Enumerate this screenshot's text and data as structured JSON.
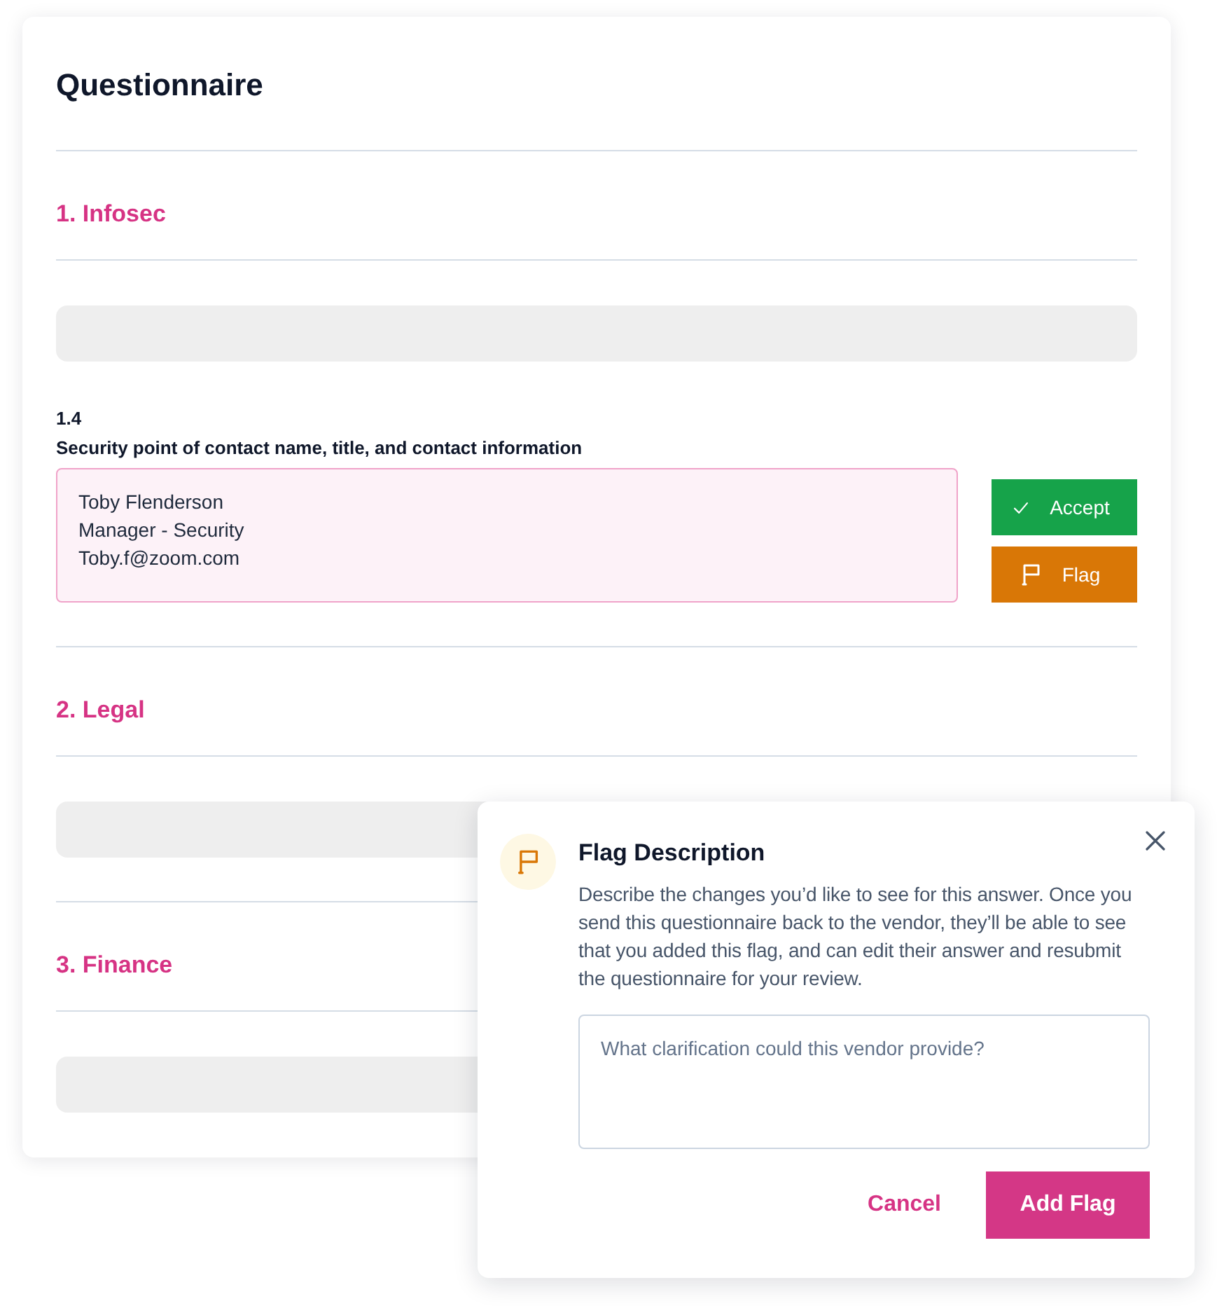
{
  "card": {
    "title": "Questionnaire",
    "sections": [
      {
        "heading": "1. Infosec",
        "question": {
          "number": "1.4",
          "label": "Security point of contact name, title, and contact information",
          "answer_lines": [
            "Toby Flenderson",
            "Manager - Security",
            "Toby.f@zoom.com"
          ],
          "flagged": true,
          "actions": [
            {
              "kind": "accept",
              "label": "Accept"
            },
            {
              "kind": "flag",
              "label": "Flag"
            }
          ]
        }
      },
      {
        "heading": "2. Legal"
      },
      {
        "heading": "3. Finance"
      }
    ]
  },
  "popover": {
    "title": "Flag Description",
    "description": "Describe the changes you’d like to see for this answer. Once you send this questionnaire back to the vendor, they’ll be able to see that you added this flag, and can edit their answer and resubmit the questionnaire for your review.",
    "field": {
      "placeholder": "What clarification could this vendor provide?"
    },
    "buttons": [
      {
        "kind": "secondary",
        "label": "Cancel"
      },
      {
        "kind": "primary",
        "label": "Add Flag"
      }
    ]
  }
}
